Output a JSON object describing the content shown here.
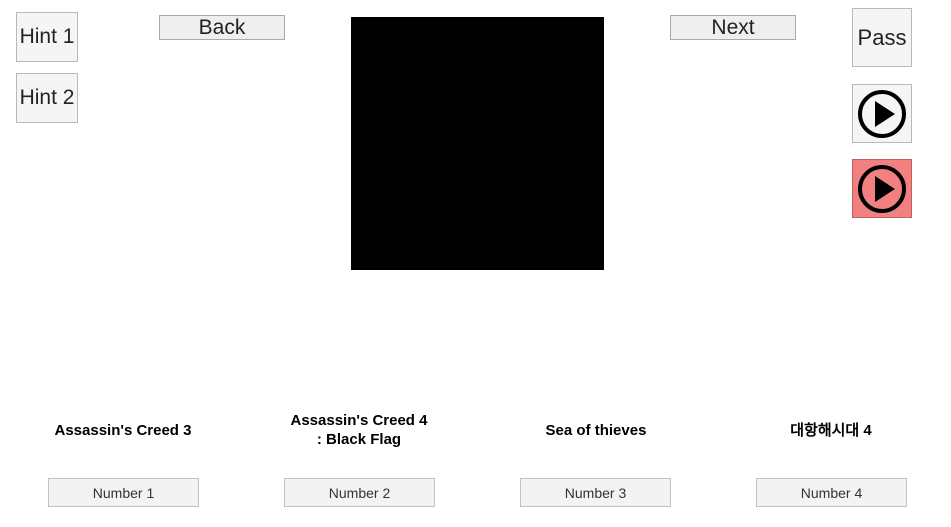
{
  "hints": [
    {
      "label": "Hint 1"
    },
    {
      "label": "Hint 2"
    }
  ],
  "nav": {
    "back_label": "Back",
    "next_label": "Next"
  },
  "side": {
    "pass_label": "Pass",
    "play_icon": "play-circle-icon",
    "play_secondary_color": "#f28080"
  },
  "media": {
    "background": "#000000"
  },
  "options": [
    {
      "title": "Assassin's Creed 3",
      "button": "Number 1"
    },
    {
      "title": "Assassin's Creed 4\n: Black Flag",
      "button": "Number 2"
    },
    {
      "title": "Sea of thieves",
      "button": "Number 3"
    },
    {
      "title": "대항해시대 4",
      "button": "Number 4"
    }
  ]
}
